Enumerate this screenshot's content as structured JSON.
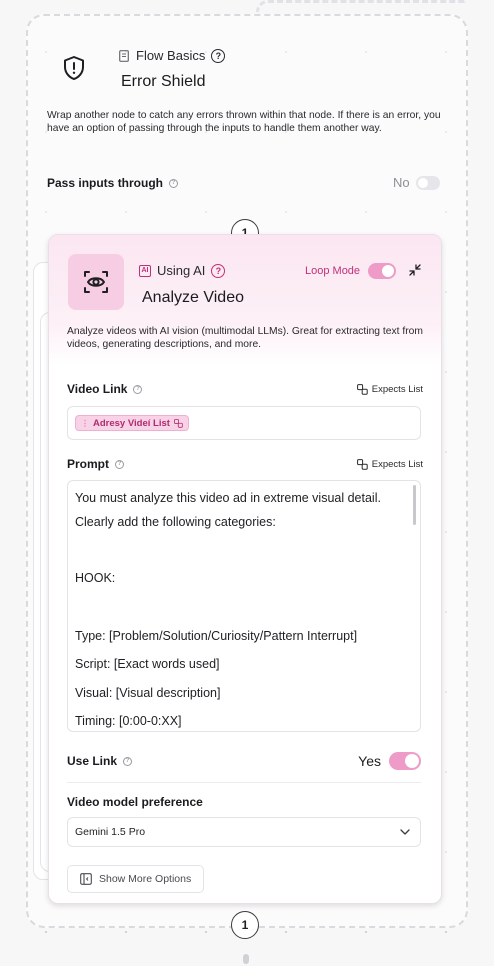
{
  "outer_node": {
    "category": "Flow Basics",
    "title": "Error Shield",
    "description": "Wrap another node to catch any errors thrown within that node. If there is an error, you have an option of passing through the inputs to handle them another way.",
    "pass_inputs_label": "Pass inputs through",
    "pass_inputs_value": "No",
    "pass_inputs_on": false
  },
  "badge_top": "1",
  "badge_bottom": "1",
  "inner_node": {
    "category": "Using AI",
    "loop_mode_label": "Loop Mode",
    "loop_mode_on": true,
    "title": "Analyze Video",
    "description": "Analyze videos with AI vision (multimodal LLMs). Great for extracting text from videos, generating descriptions, and more.",
    "video_link": {
      "label": "Video Link",
      "expects": "Expects List",
      "chip": "Adresy Videí List"
    },
    "prompt": {
      "label": "Prompt",
      "expects": "Expects List",
      "lines": [
        "You must analyze this video ad in extreme visual detail.",
        "Clearly add the following categories:",
        "",
        "HOOK:",
        "",
        "Type: [Problem/Solution/Curiosity/Pattern Interrupt]",
        "Script: [Exact words used]",
        "Visual: [Visual description]",
        "Timing: [0:00-0:XX]"
      ]
    },
    "use_link": {
      "label": "Use Link",
      "value": "Yes",
      "on": true
    },
    "model": {
      "label": "Video model preference",
      "selected": "Gemini 1.5 Pro"
    },
    "show_more": "Show More Options"
  },
  "colors": {
    "accent_pink": "#c0307a",
    "toggle_pink": "#ee9bc7",
    "header_pink": "#fbe6f1"
  }
}
